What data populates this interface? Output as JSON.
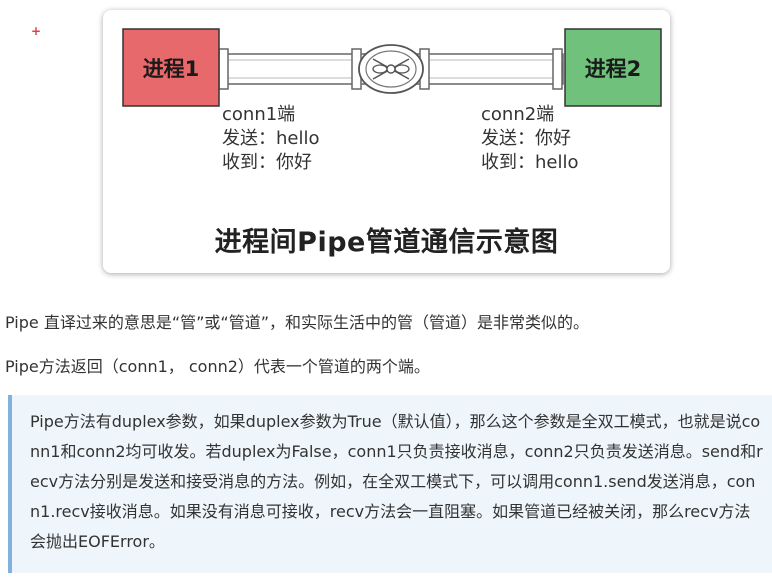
{
  "marker": "+",
  "figure": {
    "process1_label": "进程1",
    "process2_label": "进程2",
    "conn1": {
      "title": "conn1端",
      "send": "发送：hello",
      "recv": "收到：你好"
    },
    "conn2": {
      "title": "conn2端",
      "send": "发送：你好",
      "recv": "收到：hello"
    },
    "caption": "进程间Pipe管道通信示意图",
    "colors": {
      "process1": "#e8696b",
      "process2": "#6fc17c",
      "pipe": "#ffffff"
    }
  },
  "paragraphs": {
    "p1": "Pipe 直译过来的意思是“管”或“管道”，和实际生活中的管（管道）是非常类似的。",
    "p2": "Pipe方法返回（conn1， conn2）代表一个管道的两个端。"
  },
  "note": {
    "text": "Pipe方法有duplex参数，如果duplex参数为True（默认值），那么这个参数是全双工模式，也就是说conn1和conn2均可收发。若duplex为False，conn1只负责接收消息，conn2只负责发送消息。send和recv方法分别是发送和接受消息的方法。例如，在全双工模式下，可以调用conn1.send发送消息，conn1.recv接收消息。如果没有消息可接收，recv方法会一直阻塞。如果管道已经被关闭，那么recv方法会抛出EOFError。"
  }
}
